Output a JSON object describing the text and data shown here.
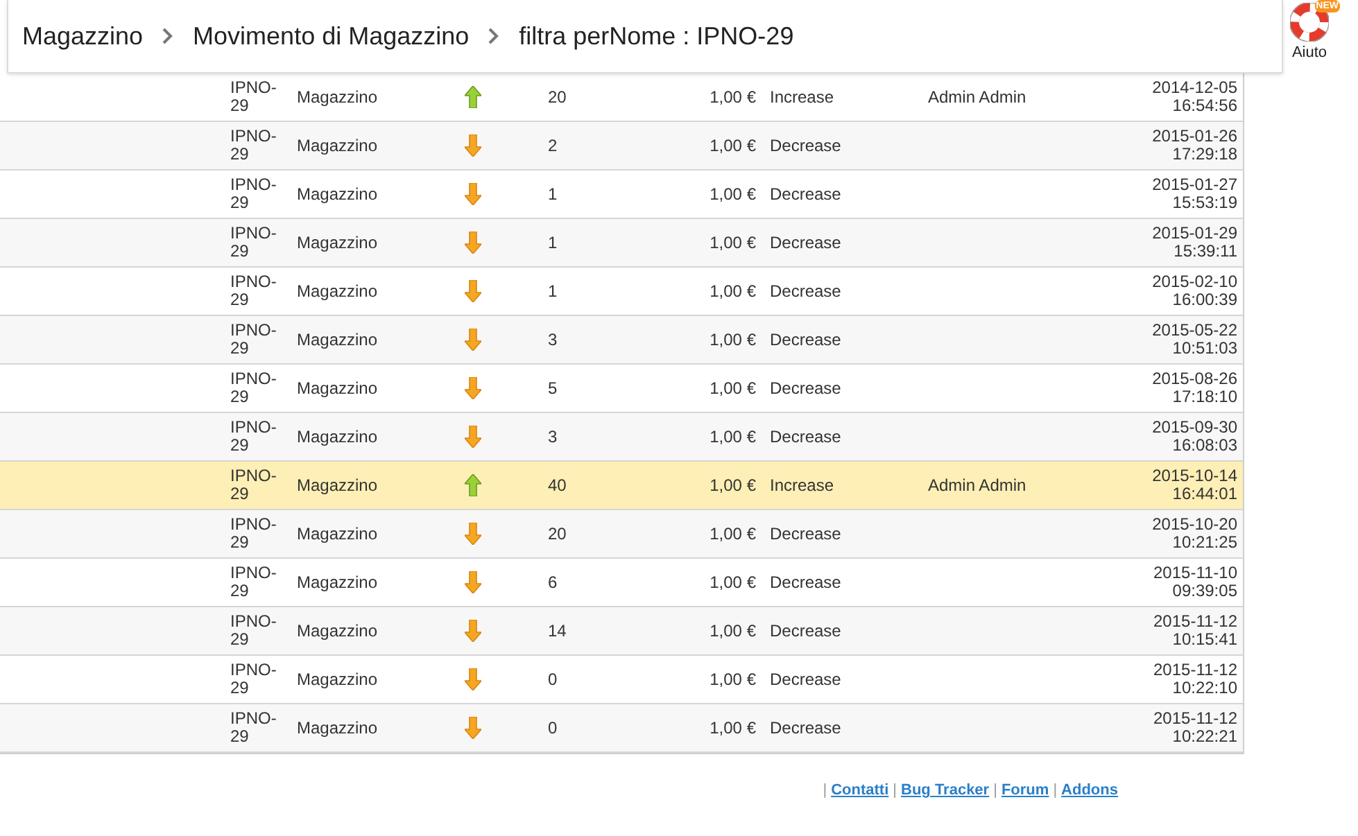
{
  "breadcrumb": [
    "Magazzino",
    "Movimento di Magazzino",
    "filtra perNome : IPNO-29"
  ],
  "help": {
    "badge": "NEW",
    "label": "Aiuto"
  },
  "rows": [
    {
      "ref": "IPNO-29",
      "warehouse": "Magazzino",
      "kind": "up",
      "qty": "20",
      "price": "1,00 €",
      "type": "Increase",
      "user": "Admin Admin",
      "date": "2014-12-05",
      "time": "16:54:56",
      "selected": false
    },
    {
      "ref": "IPNO-29",
      "warehouse": "Magazzino",
      "kind": "down",
      "qty": "2",
      "price": "1,00 €",
      "type": "Decrease",
      "date": "2015-01-26",
      "time": "17:29:18",
      "selected": false
    },
    {
      "ref": "IPNO-29",
      "warehouse": "Magazzino",
      "kind": "down",
      "qty": "1",
      "price": "1,00 €",
      "type": "Decrease",
      "date": "2015-01-27",
      "time": "15:53:19",
      "selected": false
    },
    {
      "ref": "IPNO-29",
      "warehouse": "Magazzino",
      "kind": "down",
      "qty": "1",
      "price": "1,00 €",
      "type": "Decrease",
      "date": "2015-01-29",
      "time": "15:39:11",
      "selected": false
    },
    {
      "ref": "IPNO-29",
      "warehouse": "Magazzino",
      "kind": "down",
      "qty": "1",
      "price": "1,00 €",
      "type": "Decrease",
      "date": "2015-02-10",
      "time": "16:00:39",
      "selected": false
    },
    {
      "ref": "IPNO-29",
      "warehouse": "Magazzino",
      "kind": "down",
      "qty": "3",
      "price": "1,00 €",
      "type": "Decrease",
      "date": "2015-05-22",
      "time": "10:51:03",
      "selected": false
    },
    {
      "ref": "IPNO-29",
      "warehouse": "Magazzino",
      "kind": "down",
      "qty": "5",
      "price": "1,00 €",
      "type": "Decrease",
      "date": "2015-08-26",
      "time": "17:18:10",
      "selected": false
    },
    {
      "ref": "IPNO-29",
      "warehouse": "Magazzino",
      "kind": "down",
      "qty": "3",
      "price": "1,00 €",
      "type": "Decrease",
      "date": "2015-09-30",
      "time": "16:08:03",
      "selected": false
    },
    {
      "ref": "IPNO-29",
      "warehouse": "Magazzino",
      "kind": "up",
      "qty": "40",
      "price": "1,00 €",
      "type": "Increase",
      "user": "Admin Admin",
      "date": "2015-10-14",
      "time": "16:44:01",
      "selected": true
    },
    {
      "ref": "IPNO-29",
      "warehouse": "Magazzino",
      "kind": "down",
      "qty": "20",
      "price": "1,00 €",
      "type": "Decrease",
      "date": "2015-10-20",
      "time": "10:21:25",
      "selected": false
    },
    {
      "ref": "IPNO-29",
      "warehouse": "Magazzino",
      "kind": "down",
      "qty": "6",
      "price": "1,00 €",
      "type": "Decrease",
      "date": "2015-11-10",
      "time": "09:39:05",
      "selected": false
    },
    {
      "ref": "IPNO-29",
      "warehouse": "Magazzino",
      "kind": "down",
      "qty": "14",
      "price": "1,00 €",
      "type": "Decrease",
      "date": "2015-11-12",
      "time": "10:15:41",
      "selected": false
    },
    {
      "ref": "IPNO-29",
      "warehouse": "Magazzino",
      "kind": "down",
      "qty": "0",
      "price": "1,00 €",
      "type": "Decrease",
      "date": "2015-11-12",
      "time": "10:22:10",
      "selected": false
    },
    {
      "ref": "IPNO-29",
      "warehouse": "Magazzino",
      "kind": "down",
      "qty": "0",
      "price": "1,00 €",
      "type": "Decrease",
      "date": "2015-11-12",
      "time": "10:22:21",
      "selected": false
    }
  ],
  "footer": [
    {
      "kind": "separator",
      "text": "|"
    },
    {
      "kind": "link",
      "text": "Contatti"
    },
    {
      "kind": "separator",
      "text": "|"
    },
    {
      "kind": "link",
      "text": "Bug Tracker"
    },
    {
      "kind": "separator",
      "text": "|"
    },
    {
      "kind": "link",
      "text": "Forum"
    },
    {
      "kind": "separator",
      "text": "|"
    },
    {
      "kind": "link",
      "text": "Addons"
    }
  ]
}
